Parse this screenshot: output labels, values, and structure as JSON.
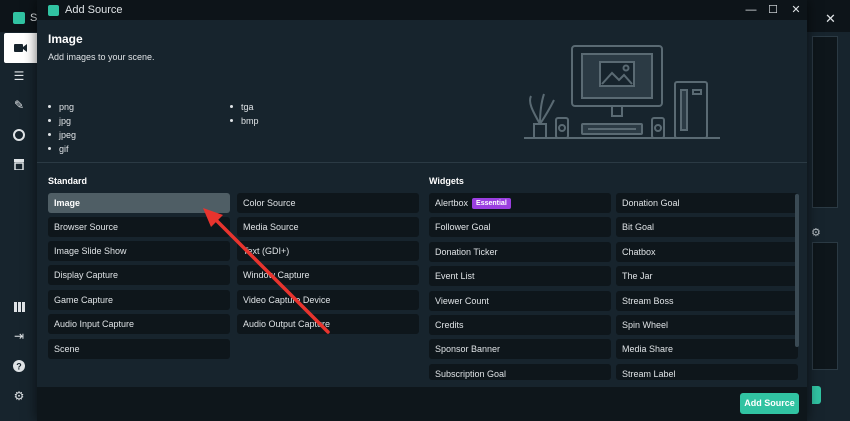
{
  "app": {
    "title": "St"
  },
  "dialog": {
    "title": "Add Source",
    "controls": {
      "minimize": "—",
      "maximize": "☐",
      "close": "✕"
    }
  },
  "source_info": {
    "title": "Image",
    "description": "Add images to your scene.",
    "formats_col1": [
      "png",
      "jpg",
      "jpeg",
      "gif"
    ],
    "formats_col2": [
      "tga",
      "bmp"
    ]
  },
  "standard": {
    "heading": "Standard",
    "col1": [
      "Image",
      "Browser Source",
      "Image Slide Show",
      "Display Capture",
      "Game Capture",
      "Audio Input Capture",
      "Scene"
    ],
    "col2": [
      "Color Source",
      "Media Source",
      "Text (GDI+)",
      "Window Capture",
      "Video Capture Device",
      "Audio Output Capture"
    ],
    "selected": "Image"
  },
  "widgets": {
    "heading": "Widgets",
    "col1": [
      "Alertbox",
      "Follower Goal",
      "Donation Ticker",
      "Event List",
      "Viewer Count",
      "Credits",
      "Sponsor Banner",
      "Subscription Goal"
    ],
    "col2": [
      "Donation Goal",
      "Bit Goal",
      "Chatbox",
      "The Jar",
      "Stream Boss",
      "Spin Wheel",
      "Media Share",
      "Stream Label"
    ],
    "alertbox_badge": "Essential"
  },
  "footer": {
    "add_button": "Add Source"
  },
  "colors": {
    "accent": "#31c3a2",
    "badge": "#9b3fe0",
    "arrow": "#e8342e"
  }
}
